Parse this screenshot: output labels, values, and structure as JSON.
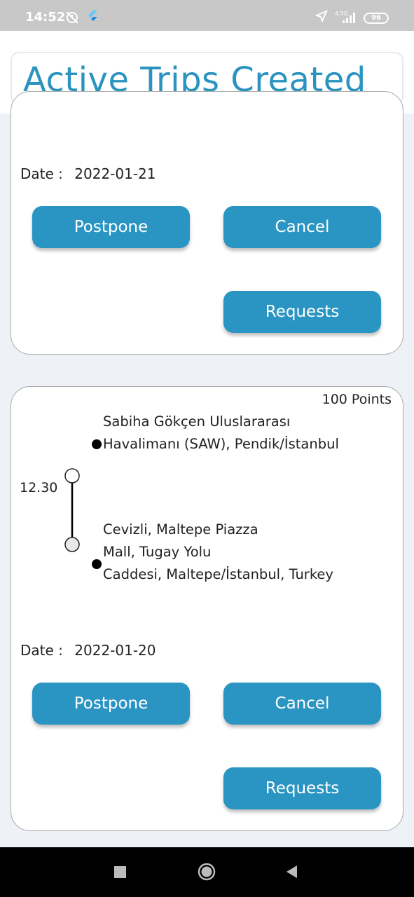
{
  "status_bar": {
    "time": "14:52",
    "network": "4.5G",
    "battery": "96",
    "icons": [
      "alarm-off-icon",
      "flutter-icon",
      "location-arrow-icon",
      "signal-icon",
      "battery-icon"
    ]
  },
  "header": {
    "title": "Active Trips Created"
  },
  "trips": [
    {
      "date_label": "Date :",
      "date": "2022-01-21",
      "postpone_label": "Postpone",
      "cancel_label": "Cancel",
      "requests_label": "Requests"
    },
    {
      "points": "100 Points",
      "time": "12.30",
      "from_line1": "Sabiha Gökçen Uluslararası",
      "from_line2": "Havalimanı (SAW), Pendik/İstanbul",
      "to_line1": "Cevizli, Maltepe Piazza",
      "to_line2": "Mall, Tugay Yolu",
      "to_line3": "Caddesi, Maltepe/İstanbul, Turkey",
      "date_label": "Date :",
      "date": "2022-01-20",
      "postpone_label": "Postpone",
      "cancel_label": "Cancel",
      "requests_label": "Requests"
    }
  ],
  "colors": {
    "accent": "#2a95c2",
    "title": "#2a93c0",
    "background": "#eef2f6"
  },
  "nav_bar": {
    "icons": [
      "recent-apps-icon",
      "home-icon",
      "back-icon"
    ]
  }
}
